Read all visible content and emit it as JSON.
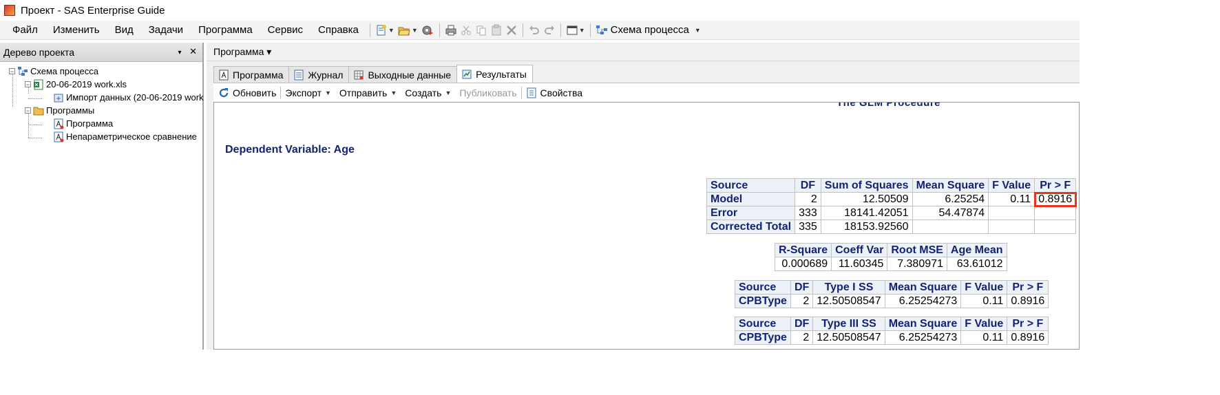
{
  "window": {
    "title": "Проект - SAS Enterprise Guide"
  },
  "menu": [
    "Файл",
    "Изменить",
    "Вид",
    "Задачи",
    "Программа",
    "Сервис",
    "Справка"
  ],
  "toolbar": {
    "flow_label": "Схема процесса"
  },
  "project_tree": {
    "title": "Дерево проекта",
    "pin": "▾",
    "close": "✕",
    "nodes": {
      "flow": "Схема процесса",
      "file": "20-06-2019 work.xls",
      "import": "Импорт данных (20-06-2019 work",
      "programs": "Программы",
      "program": "Программа",
      "nonparam": "Непараметрическое сравнение"
    }
  },
  "workspace": {
    "header": "Программа ▾",
    "tabs": [
      "Программа",
      "Журнал",
      "Выходные данные",
      "Результаты"
    ],
    "active_tab": "Результаты",
    "results_toolbar": {
      "refresh": "Обновить",
      "export": "Экспорт",
      "send": "Отправить",
      "create": "Создать",
      "publish": "Публиковать",
      "properties": "Свойства"
    }
  },
  "results": {
    "procedure_title": "The GLM Procedure",
    "dependent_variable": "Dependent Variable: Age",
    "anova": {
      "headers": [
        "Source",
        "DF",
        "Sum of Squares",
        "Mean Square",
        "F Value",
        "Pr > F"
      ],
      "rows": [
        [
          "Model",
          "2",
          "12.50509",
          "6.25254",
          "0.11",
          "0.8916"
        ],
        [
          "Error",
          "333",
          "18141.42051",
          "54.47874",
          "",
          ""
        ],
        [
          "Corrected Total",
          "335",
          "18153.92560",
          "",
          "",
          ""
        ]
      ]
    },
    "fit": {
      "headers": [
        "R-Square",
        "Coeff Var",
        "Root MSE",
        "Age Mean"
      ],
      "values": [
        "0.000689",
        "11.60345",
        "7.380971",
        "63.61012"
      ]
    },
    "type1": {
      "headers": [
        "Source",
        "DF",
        "Type I SS",
        "Mean Square",
        "F Value",
        "Pr > F"
      ],
      "row": [
        "CPBType",
        "2",
        "12.50508547",
        "6.25254273",
        "0.11",
        "0.8916"
      ]
    },
    "type3": {
      "headers": [
        "Source",
        "DF",
        "Type III SS",
        "Mean Square",
        "F Value",
        "Pr > F"
      ],
      "row": [
        "CPBType",
        "2",
        "12.50508547",
        "6.25254273",
        "0.11",
        "0.8916"
      ]
    },
    "highlight_color": "#e8331e"
  }
}
